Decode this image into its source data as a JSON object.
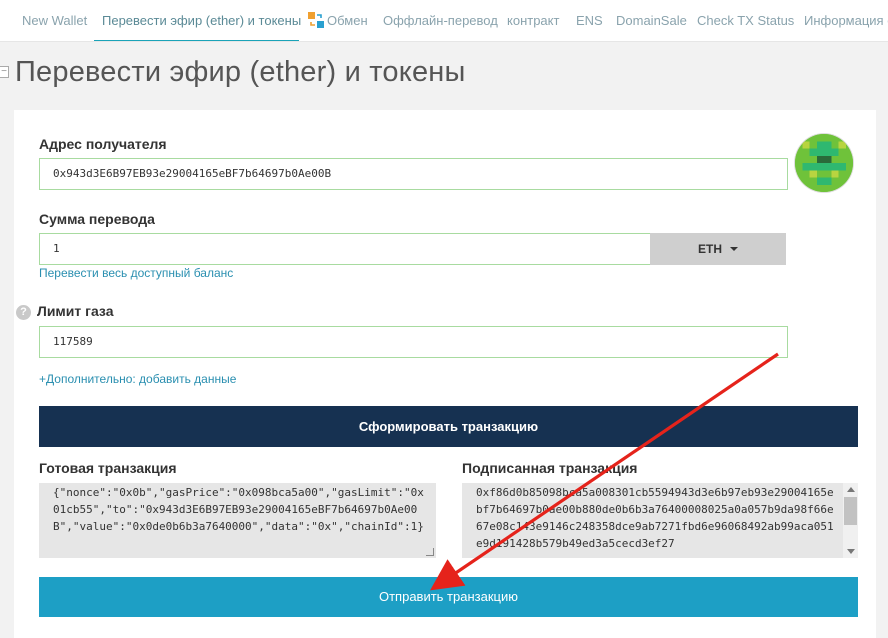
{
  "nav": {
    "tabs": [
      {
        "label": "New Wallet"
      },
      {
        "label": "Перевести эфир (ether) и токены"
      },
      {
        "label": "Обмен"
      },
      {
        "label": "Оффлайн-перевод"
      },
      {
        "label": "контракт"
      },
      {
        "label": "ENS"
      },
      {
        "label": "DomainSale"
      },
      {
        "label": "Check TX Status"
      },
      {
        "label": "Информация о"
      }
    ],
    "active_tab": "Перевести эфир (ether) и токены"
  },
  "page": {
    "title": "Перевести эфир (ether) и токены",
    "collapse_glyph": "−"
  },
  "form": {
    "recipient": {
      "label": "Адрес получателя",
      "value": "0x943d3E6B97EB93e29004165eBF7b64697b0Ae00B"
    },
    "amount": {
      "label": "Сумма перевода",
      "value": "1",
      "currency": "ETH",
      "send_all_link": "Перевести весь доступный баланс"
    },
    "gas": {
      "label": "Лимит газа",
      "value": "117589",
      "help_glyph": "?"
    },
    "advanced_link": "+Дополнительно: добавить данные",
    "generate_button": "Сформировать транзакцию"
  },
  "transactions": {
    "raw": {
      "label": "Готовая транзакция",
      "value": "{\"nonce\":\"0x0b\",\"gasPrice\":\"0x098bca5a00\",\"gasLimit\":\"0x01cb55\",\"to\":\"0x943d3E6B97EB93e29004165eBF7b64697b0Ae00B\",\"value\":\"0x0de0b6b3a7640000\",\"data\":\"0x\",\"chainId\":1}"
    },
    "signed": {
      "label": "Подписанная транзакция",
      "value": "0xf86d0b85098bca5a008301cb5594943d3e6b97eb93e29004165ebf7b64697b0ae00b880de0b6b3a76400008025a0a057b9da98f66e67e08c143e9146c248358dce9ab7271fbd6e96068492ab99aca051e9d191428b579b49ed3a5cecd3ef27"
    }
  },
  "send_button": "Отправить транзакцию",
  "colors": {
    "navy": "#163151",
    "teal": "#1d9fc5",
    "annotation_arrow": "#e5231b"
  }
}
